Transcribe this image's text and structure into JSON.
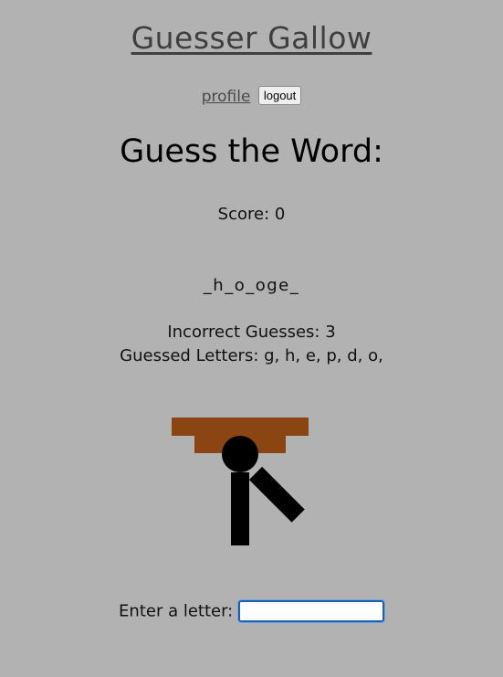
{
  "header": {
    "title": "Guesser Gallow",
    "profile_link": "profile",
    "logout_label": "logout"
  },
  "game": {
    "heading": "Guess the Word:",
    "score_text": "Score: 0",
    "word_display": "_h_o_oge_",
    "incorrect_text": "Incorrect Guesses: 3",
    "guessed_text": "Guessed Letters: g, h, e, p, d, o,",
    "incorrect_count": 3
  },
  "gallow": {
    "wood_color": "#8b4513",
    "figure_color": "#000000",
    "parts_shown": [
      "head",
      "body",
      "arm"
    ]
  },
  "input": {
    "label": "Enter a letter:",
    "value": ""
  }
}
